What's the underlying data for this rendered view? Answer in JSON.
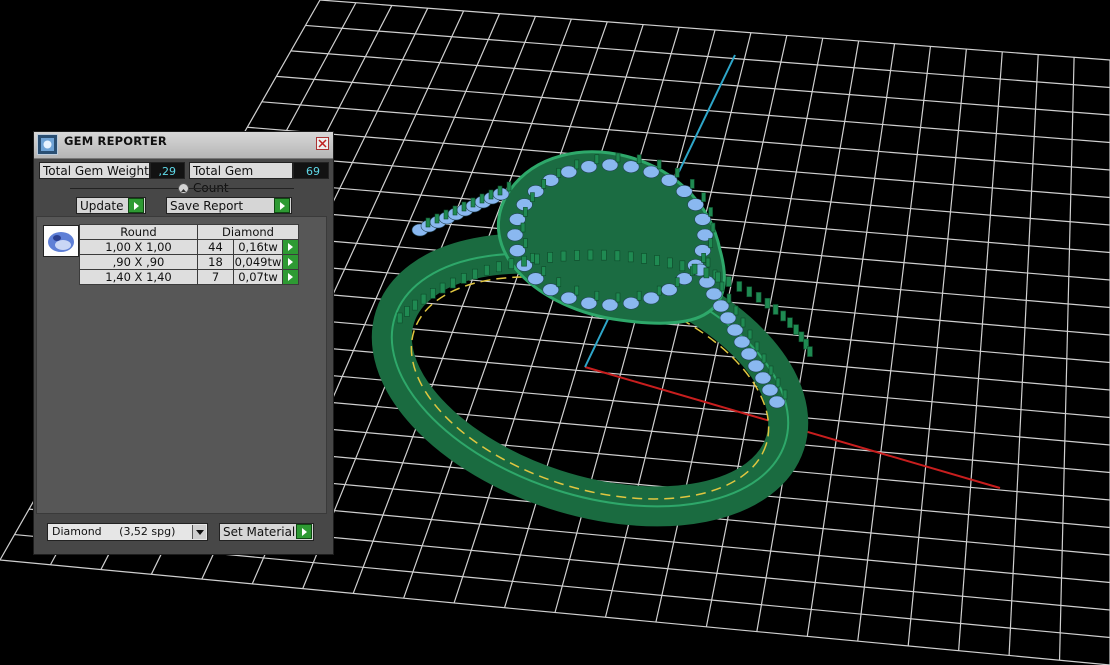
{
  "panel": {
    "title": "GEM REPORTER",
    "total_weight_label": "Total Gem Weight",
    "total_weight_value": ",29",
    "total_count_label": "Total Gem Count",
    "total_count_value": "69",
    "update_label": "Update",
    "save_report_label": "Save Report",
    "table": {
      "headers": [
        "Round",
        "Diamond"
      ],
      "rows": [
        {
          "size": "1,00 X 1,00",
          "count": "44",
          "weight": "0,16tw"
        },
        {
          "size": ",90 X ,90",
          "count": "18",
          "weight": "0,049tw"
        },
        {
          "size": "1,40 X 1,40",
          "count": "7",
          "weight": "0,07tw"
        }
      ]
    },
    "material_value": "Diamond     (3,52 spg)",
    "set_material_label": "Set Material"
  },
  "colors": {
    "grid": "#d8d8d8",
    "ring_metal": "#1f7a4a",
    "gems": "#8ab8f0",
    "axis_x": "#d11f1f",
    "axis_y": "#2ea6c9",
    "accent_button": "#2e9a33"
  }
}
